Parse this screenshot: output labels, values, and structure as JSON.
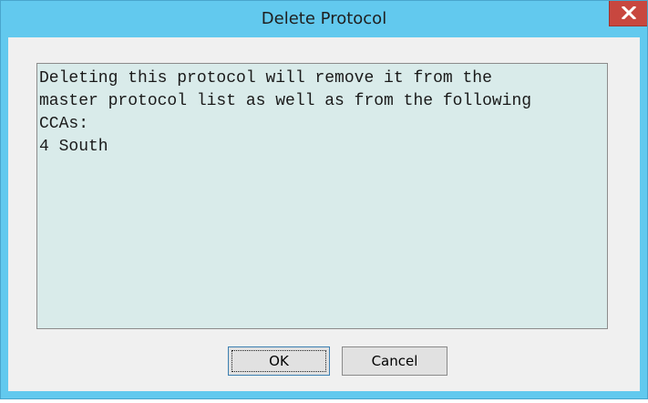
{
  "dialog": {
    "title": "Delete Protocol",
    "close_icon": "close-x-icon",
    "message_lines": [
      "Deleting this protocol will remove it from the",
      "master protocol list as well as from the following",
      "CCAs:",
      "4 South"
    ],
    "ok_label": "OK",
    "cancel_label": "Cancel"
  },
  "colors": {
    "title_bar": "#62c9ee",
    "close_button": "#c8473f",
    "message_background": "#d9ebea",
    "client_background": "#f0f0f0"
  }
}
